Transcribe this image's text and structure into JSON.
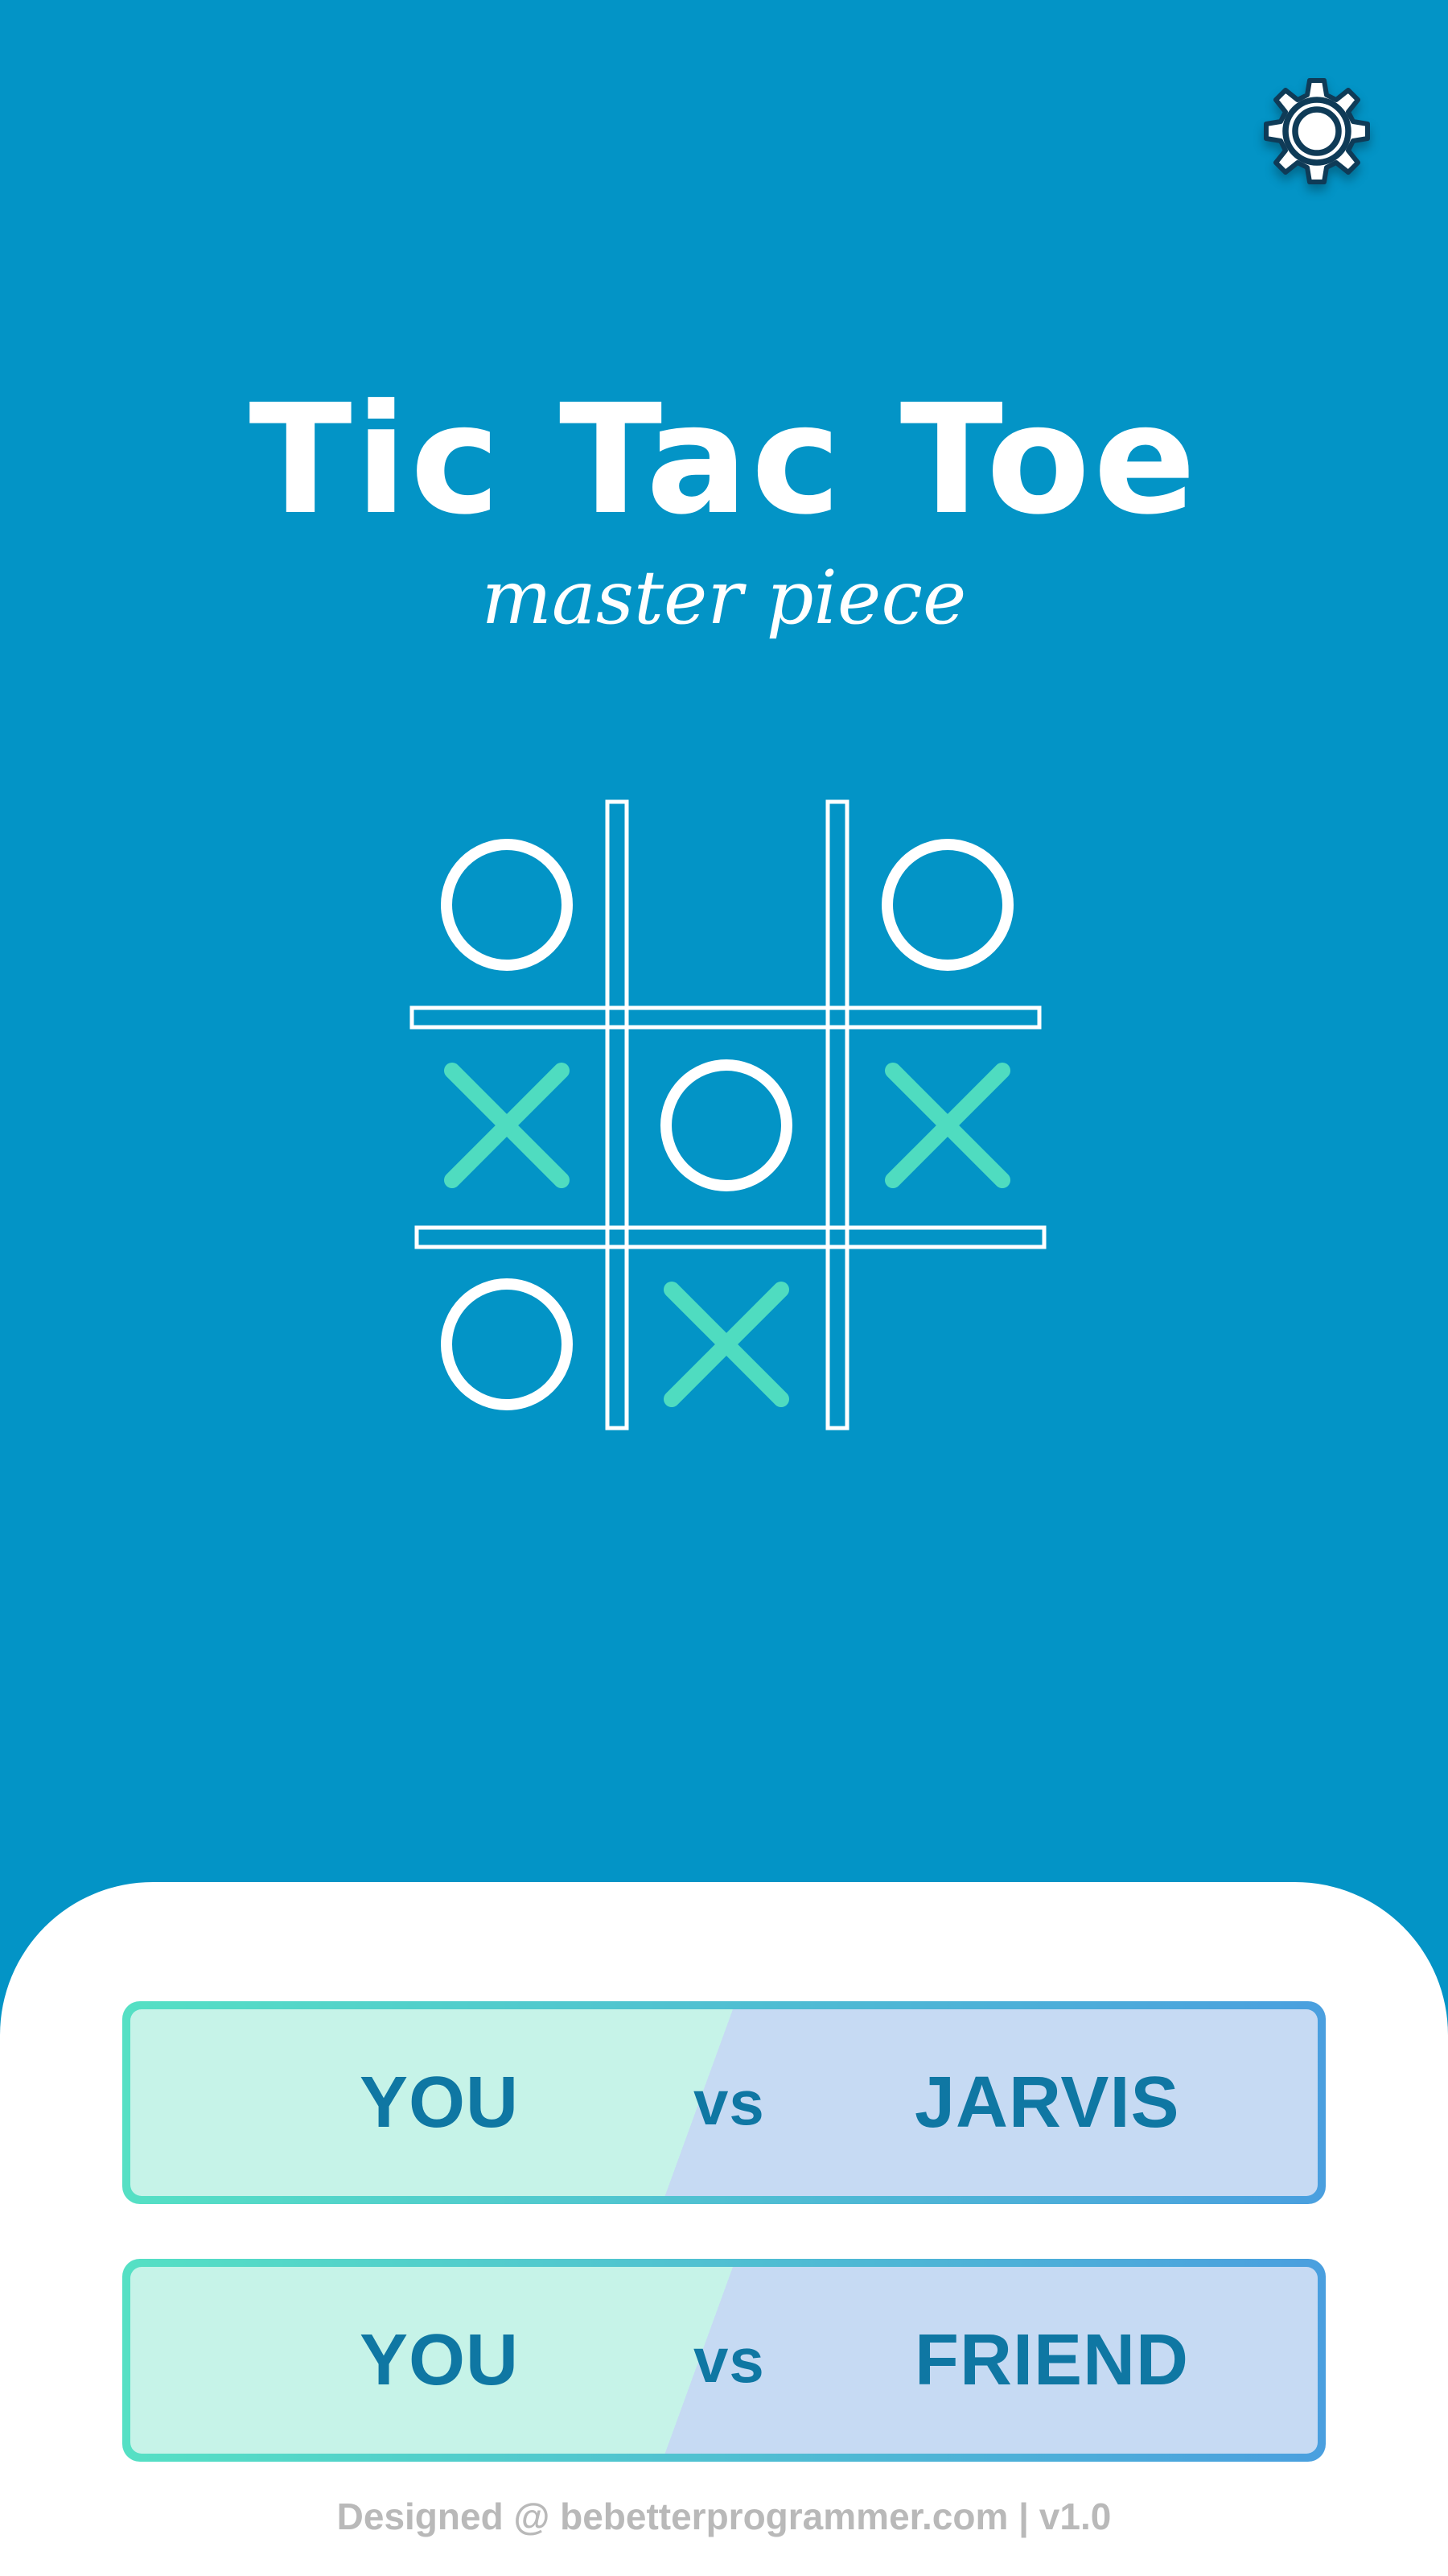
{
  "header": {
    "settings_icon": "gear-icon"
  },
  "title": "Tic Tac Toe",
  "subtitle": "master piece",
  "board": {
    "cells": [
      "O",
      "",
      "O",
      "X",
      "O",
      "X",
      "O",
      "X",
      ""
    ]
  },
  "modes": [
    {
      "left": "YOU",
      "vs": "vs",
      "right": "JARVIS"
    },
    {
      "left": "YOU",
      "vs": "vs",
      "right": "FRIEND"
    }
  ],
  "footer": "Designed @ bebetterprogrammer.com | v1.0",
  "colors": {
    "background": "#0394c6",
    "x_mark": "#4fdcc0",
    "o_mark": "#ffffff",
    "button_text": "#0f77a3",
    "gear": "#0f3b57"
  }
}
